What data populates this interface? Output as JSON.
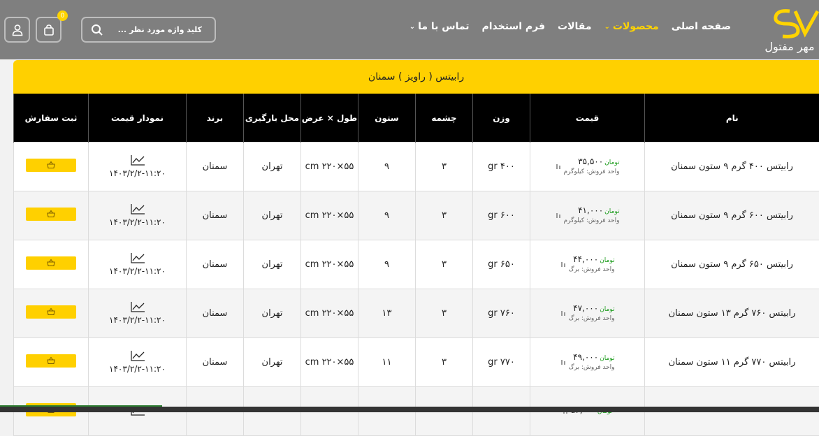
{
  "header": {
    "logo_text": "مهر مفتول",
    "nav": [
      {
        "label": "صفحه اصلی",
        "active": false,
        "dropdown": false
      },
      {
        "label": "محصولات",
        "active": true,
        "dropdown": true
      },
      {
        "label": "مقالات",
        "active": false,
        "dropdown": false
      },
      {
        "label": "فرم استخدام",
        "active": false,
        "dropdown": false
      },
      {
        "label": "تماس با ما",
        "active": false,
        "dropdown": true
      }
    ],
    "search_placeholder": "کلید واژه مورد نظر ...",
    "cart_count": "0",
    "accent": "#ffd000"
  },
  "table": {
    "title": "رابیتس ( راویز )   سمنان",
    "headers": [
      "نام",
      "قیمت",
      "وزن",
      "چشمه",
      "ستون",
      "طول × عرض",
      "محل بارگیری",
      "برند",
      "نمودار قیمت",
      "ثبت سفارش"
    ],
    "rows": [
      {
        "name": "رابیتس ۴۰۰ گرم ۹ ستون سمنان",
        "price": "۳۵,۵۰۰",
        "currency": "تومان",
        "unit": "واحد فروش: کیلوگرم",
        "weight": "۴۰۰ gr",
        "mesh": "۳",
        "columns": "۹",
        "size": "۵۵×۲۲۰ cm",
        "place": "تهران",
        "brand": "سمنان",
        "date": "۱۴۰۳/۲/۲-۱۱:۲۰"
      },
      {
        "name": "رابیتس ۶۰۰ گرم ۹ ستون سمنان",
        "price": "۴۱,۰۰۰",
        "currency": "تومان",
        "unit": "واحد فروش: کیلوگرم",
        "weight": "۶۰۰ gr",
        "mesh": "۳",
        "columns": "۹",
        "size": "۵۵×۲۲۰ cm",
        "place": "تهران",
        "brand": "سمنان",
        "date": "۱۴۰۳/۲/۲-۱۱:۲۰"
      },
      {
        "name": "رابیتس ۶۵۰ گرم ۹ ستون سمنان",
        "price": "۴۴,۰۰۰",
        "currency": "تومان",
        "unit": "واحد فروش: برگ",
        "weight": "۶۵۰ gr",
        "mesh": "۳",
        "columns": "۹",
        "size": "۵۵×۲۲۰ cm",
        "place": "تهران",
        "brand": "سمنان",
        "date": "۱۴۰۳/۲/۲-۱۱:۲۰"
      },
      {
        "name": "رابیتس ۷۶۰ گرم ۱۳ ستون سمنان",
        "price": "۴۷,۰۰۰",
        "currency": "تومان",
        "unit": "واحد فروش: برگ",
        "weight": "۷۶۰ gr",
        "mesh": "۳",
        "columns": "۱۳",
        "size": "۵۵×۲۲۰ cm",
        "place": "تهران",
        "brand": "سمنان",
        "date": "۱۴۰۳/۲/۲-۱۱:۲۰"
      },
      {
        "name": "رابیتس ۷۷۰ گرم ۱۱ ستون سمنان",
        "price": "۴۹,۰۰۰",
        "currency": "تومان",
        "unit": "واحد فروش: برگ",
        "weight": "۷۷۰ gr",
        "mesh": "۳",
        "columns": "۱۱",
        "size": "۵۵×۲۲۰ cm",
        "place": "تهران",
        "brand": "سمنان",
        "date": "۱۴۰۳/۲/۲-۱۱:۲۰"
      },
      {
        "name": "",
        "price": "۵۴,۰۰۰",
        "currency": "تومان",
        "unit": "",
        "weight": "",
        "mesh": "",
        "columns": "",
        "size": "",
        "place": "",
        "brand": "",
        "date": ""
      }
    ]
  }
}
